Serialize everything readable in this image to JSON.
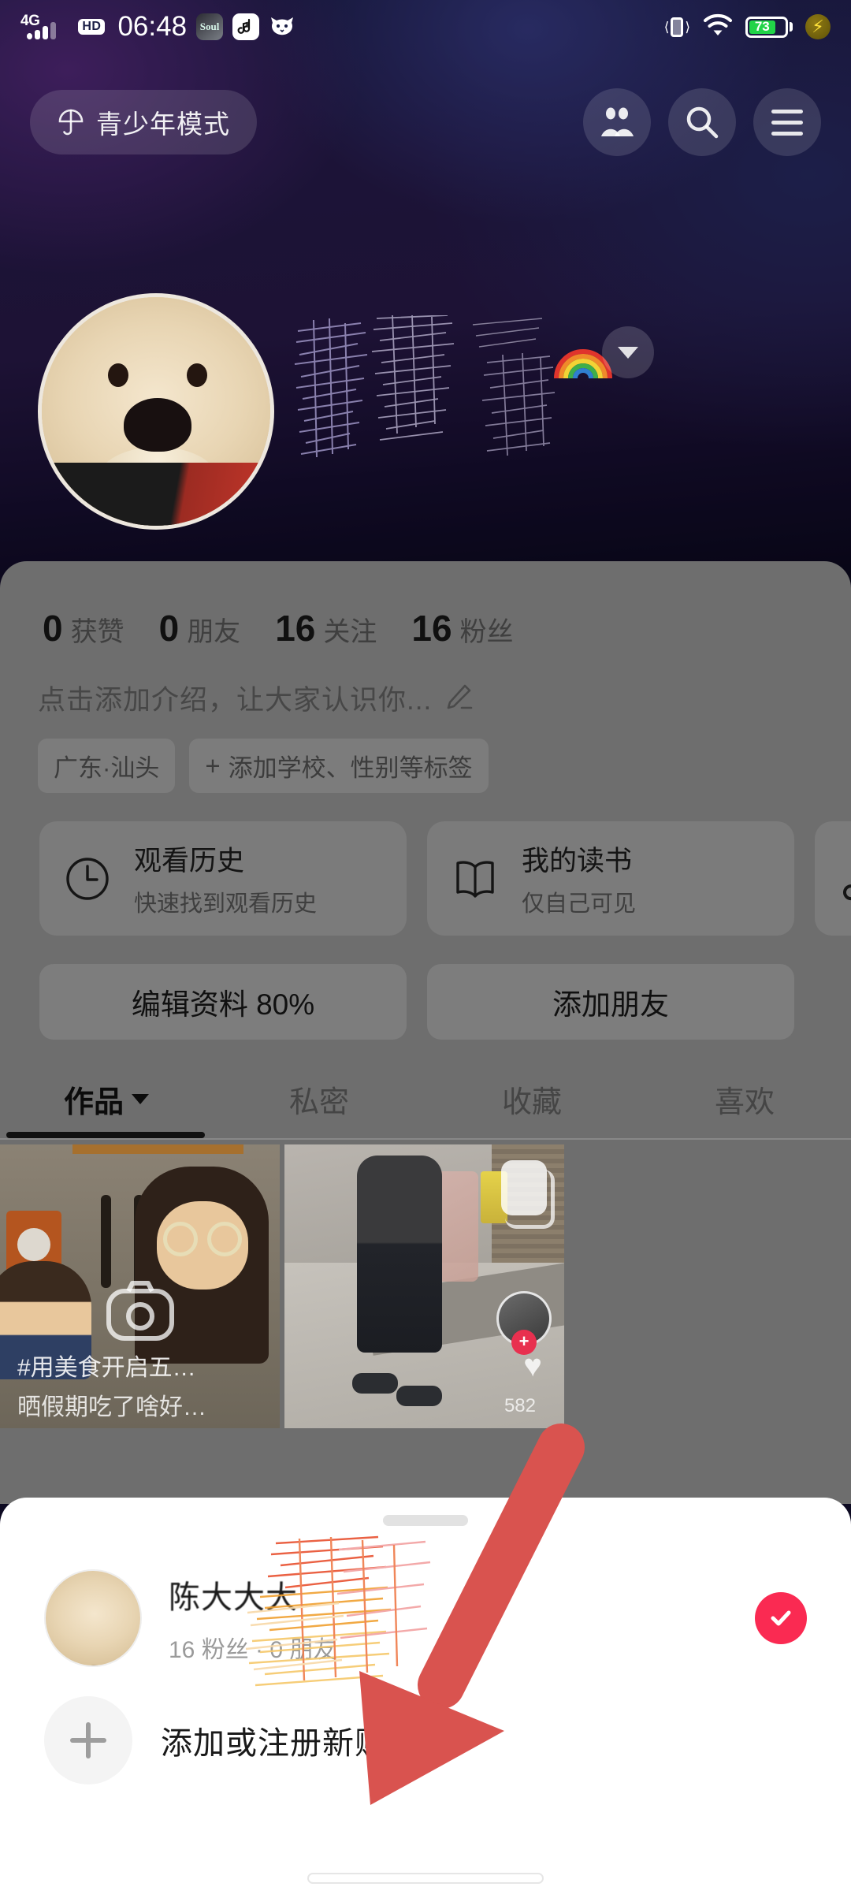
{
  "status_bar": {
    "network": "4G",
    "hd_badge": "HD",
    "time": "06:48",
    "app_icons": [
      "soul-app-icon",
      "music-app-icon",
      "cat-app-icon"
    ],
    "vibrate_icon": "vibrate-icon",
    "wifi_icon": "wifi-icon",
    "battery_percent": "73",
    "battery_color": "#21d448",
    "flash_icon": "power-saving-icon"
  },
  "top_nav": {
    "teen_mode_label": "青少年模式",
    "teen_mode_icon": "umbrella-icon",
    "friends_icon": "friends-icon",
    "search_icon": "search-icon",
    "menu_icon": "hamburger-menu-icon"
  },
  "profile": {
    "avatar": "dog-avatar",
    "display_name_redacted": true,
    "rainbow_emoji": "rainbow-icon",
    "expand_icon": "chevron-down-icon",
    "stats": [
      {
        "value": "0",
        "label": "获赞"
      },
      {
        "value": "0",
        "label": "朋友"
      },
      {
        "value": "16",
        "label": "关注"
      },
      {
        "value": "16",
        "label": "粉丝"
      }
    ],
    "bio_placeholder": "点击添加介绍，让大家认识你...",
    "bio_edit_icon": "pencil-icon",
    "tags": [
      {
        "text": "广东·汕头",
        "has_plus": false
      },
      {
        "text": "添加学校、性别等标签",
        "has_plus": true,
        "plus": "+"
      }
    ],
    "cards": [
      {
        "icon": "clock-icon",
        "title": "观看历史",
        "subtitle": "快速找到观看历史"
      },
      {
        "icon": "book-icon",
        "title": "我的读书",
        "subtitle": "仅自己可见"
      },
      {
        "icon": "music-note-icon",
        "title": "",
        "subtitle": ""
      }
    ],
    "actions": [
      {
        "label": "编辑资料 80%"
      },
      {
        "label": "添加朋友"
      }
    ],
    "tabs": [
      {
        "label": "作品",
        "active": true,
        "has_caret": true
      },
      {
        "label": "私密",
        "active": false,
        "has_caret": false
      },
      {
        "label": "收藏",
        "active": false,
        "has_caret": false
      },
      {
        "label": "喜欢",
        "active": false,
        "has_caret": false
      }
    ],
    "grid": [
      {
        "caption_1": "#用美食开启五…",
        "caption_2": "晒假期吃了啥好…",
        "overlay_icon": "camera-icon"
      },
      {
        "caption_1": "",
        "caption_2": "",
        "like_count": "582",
        "overlay_icon": "heart-icon",
        "follow_icon": "plus-follow-icon",
        "multi_icon": "multi-frame-icon"
      }
    ]
  },
  "bottom_sheet": {
    "drag_handle": "drag-handle",
    "account": {
      "avatar": "dog-avatar",
      "name": "陈大大大",
      "meta": "16 粉丝 · 0 朋友",
      "selected": true,
      "check_icon": "check-circle-icon",
      "check_color": "#fa2a52"
    },
    "add_account": {
      "icon": "plus-icon",
      "label": "添加或注册新账号"
    }
  },
  "annotation": {
    "arrow_icon": "red-arrow-annotation",
    "arrow_color": "#d9534f",
    "points_to": "添加或注册新账号"
  }
}
